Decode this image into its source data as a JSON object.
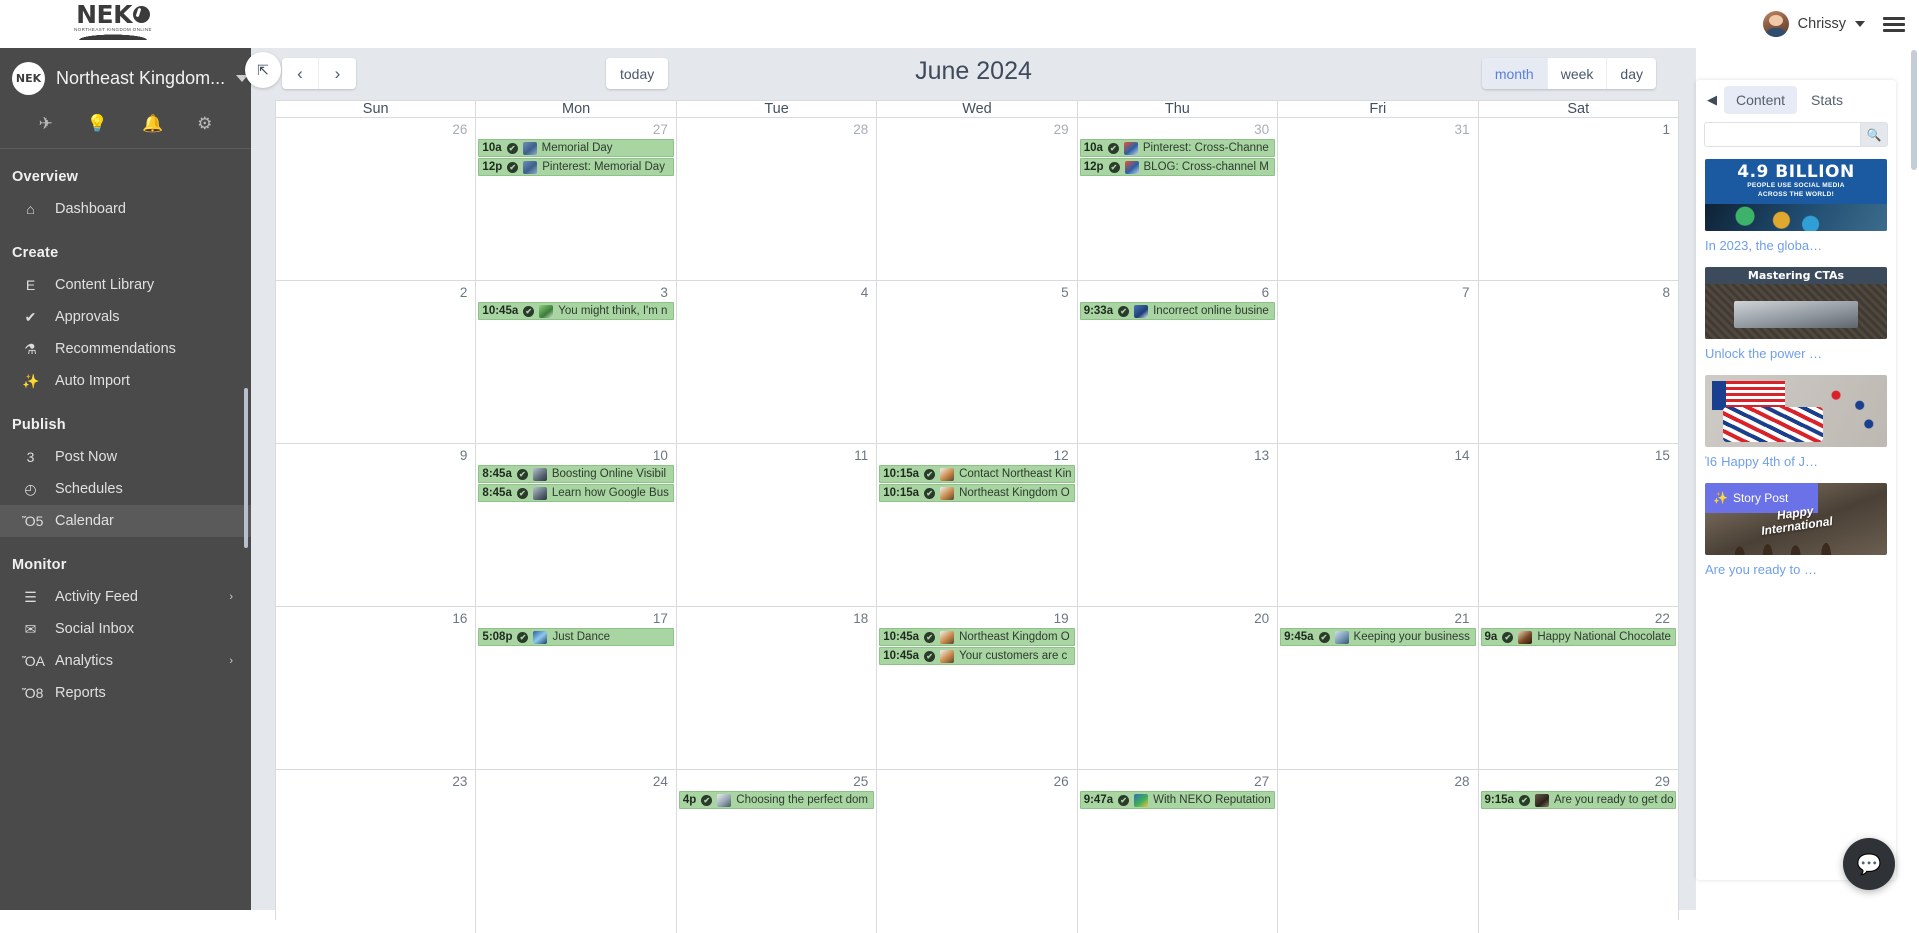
{
  "topbar": {
    "brand_word": "NEK",
    "brand_tagline": "NORTHEAST KINGDOM ONLINE",
    "user_name": "Chrissy",
    "avatar_icon": "user-avatar",
    "menu_icon": "hamburger-menu-icon"
  },
  "sidebar": {
    "account_logo_text": "NEK",
    "account_name": "Northeast Kingdom...",
    "quick_icons": [
      {
        "name": "rocket-icon",
        "glyph": "✈"
      },
      {
        "name": "lightbulb-icon",
        "glyph": "Ὂ1"
      },
      {
        "name": "bell-icon",
        "glyph": "ὑ4"
      },
      {
        "name": "gear-icon",
        "glyph": "⚙"
      }
    ],
    "sections": [
      {
        "title": "Overview",
        "items": [
          {
            "label": "Dashboard",
            "icon": "home-icon",
            "glyph": "⌂",
            "active": false,
            "chevron": false
          }
        ]
      },
      {
        "title": "Create",
        "items": [
          {
            "label": "Content Library",
            "icon": "document-image-icon",
            "glyph": "὜E",
            "active": false,
            "chevron": false
          },
          {
            "label": "Approvals",
            "icon": "check-circle-icon",
            "glyph": "✔",
            "active": false,
            "chevron": false
          },
          {
            "label": "Recommendations",
            "icon": "flask-icon",
            "glyph": "⚗",
            "active": false,
            "chevron": false
          },
          {
            "label": "Auto Import",
            "icon": "magic-wand-icon",
            "glyph": "✨",
            "active": false,
            "chevron": false
          }
        ]
      },
      {
        "title": "Publish",
        "items": [
          {
            "label": "Post Now",
            "icon": "megaphone-icon",
            "glyph": "὎3",
            "active": false,
            "chevron": false
          },
          {
            "label": "Schedules",
            "icon": "clock-icon",
            "glyph": "◴",
            "active": false,
            "chevron": false
          },
          {
            "label": "Calendar",
            "icon": "calendar-icon",
            "glyph": "Ὄ5",
            "active": true,
            "chevron": false
          }
        ]
      },
      {
        "title": "Monitor",
        "items": [
          {
            "label": "Activity Feed",
            "icon": "list-icon",
            "glyph": "☰",
            "active": false,
            "chevron": true
          },
          {
            "label": "Social Inbox",
            "icon": "envelope-icon",
            "glyph": "✉",
            "active": false,
            "chevron": false
          },
          {
            "label": "Analytics",
            "icon": "bar-chart-icon",
            "glyph": "ὌA",
            "active": false,
            "chevron": true
          },
          {
            "label": "Reports",
            "icon": "area-chart-icon",
            "glyph": "Ὄ8",
            "active": false,
            "chevron": false
          }
        ]
      }
    ]
  },
  "calendar": {
    "title": "June 2024",
    "collapse_icon": "collapse-arrows-icon",
    "prev_label": "‹",
    "next_label": "›",
    "today_label": "today",
    "views": [
      {
        "label": "month",
        "active": true
      },
      {
        "label": "week",
        "active": false
      },
      {
        "label": "day",
        "active": false
      }
    ],
    "day_headers": [
      "Sun",
      "Mon",
      "Tue",
      "Wed",
      "Thu",
      "Fri",
      "Sat"
    ],
    "weeks": [
      [
        {
          "num": "26",
          "other": true,
          "events": []
        },
        {
          "num": "27",
          "other": true,
          "events": [
            {
              "time": "10a",
              "title": "Memorial Day",
              "thumb": "t-pin"
            },
            {
              "time": "12p",
              "title": "Pinterest: Memorial Day",
              "thumb": "t-pin"
            }
          ]
        },
        {
          "num": "28",
          "other": true,
          "events": []
        },
        {
          "num": "29",
          "other": true,
          "events": []
        },
        {
          "num": "30",
          "other": true,
          "events": [
            {
              "time": "10a",
              "title": "Pinterest: Cross-Channe",
              "thumb": "t-blog"
            },
            {
              "time": "12p",
              "title": "BLOG: Cross-channel M",
              "thumb": "t-blog"
            }
          ]
        },
        {
          "num": "31",
          "other": true,
          "events": []
        },
        {
          "num": "1",
          "other": false,
          "events": []
        }
      ],
      [
        {
          "num": "2",
          "other": false,
          "events": []
        },
        {
          "num": "3",
          "other": false,
          "events": [
            {
              "time": "10:45a",
              "title": "You might think, I'm n",
              "thumb": "t-green"
            }
          ]
        },
        {
          "num": "4",
          "other": false,
          "events": []
        },
        {
          "num": "5",
          "other": false,
          "events": []
        },
        {
          "num": "6",
          "other": false,
          "events": [
            {
              "time": "9:33a",
              "title": "Incorrect online busine",
              "thumb": "t-blue"
            }
          ]
        },
        {
          "num": "7",
          "other": false,
          "events": []
        },
        {
          "num": "8",
          "other": false,
          "events": []
        }
      ],
      [
        {
          "num": "9",
          "other": false,
          "events": []
        },
        {
          "num": "10",
          "other": false,
          "events": [
            {
              "time": "8:45a",
              "title": "Boosting Online Visibil",
              "thumb": "t-lap"
            },
            {
              "time": "8:45a",
              "title": "Learn how Google Bus",
              "thumb": "t-lap"
            }
          ]
        },
        {
          "num": "11",
          "other": false,
          "events": []
        },
        {
          "num": "12",
          "other": false,
          "events": [
            {
              "time": "10:15a",
              "title": "Contact Northeast Kin",
              "thumb": "t-cat"
            },
            {
              "time": "10:15a",
              "title": "Northeast Kingdom O",
              "thumb": "t-cat"
            }
          ]
        },
        {
          "num": "13",
          "other": false,
          "events": []
        },
        {
          "num": "14",
          "other": false,
          "events": []
        },
        {
          "num": "15",
          "other": false,
          "events": []
        }
      ],
      [
        {
          "num": "16",
          "other": false,
          "events": []
        },
        {
          "num": "17",
          "other": false,
          "events": [
            {
              "time": "5:08p",
              "title": "Just Dance",
              "thumb": "t-dance"
            }
          ]
        },
        {
          "num": "18",
          "other": false,
          "events": []
        },
        {
          "num": "19",
          "other": false,
          "events": [
            {
              "time": "10:45a",
              "title": "Northeast Kingdom O",
              "thumb": "t-cat"
            },
            {
              "time": "10:45a",
              "title": "Your customers are c",
              "thumb": "t-cat"
            }
          ]
        },
        {
          "num": "20",
          "other": false,
          "events": []
        },
        {
          "num": "21",
          "other": false,
          "events": [
            {
              "time": "9:45a",
              "title": "Keeping your business",
              "thumb": "t-news"
            }
          ]
        },
        {
          "num": "22",
          "other": false,
          "events": [
            {
              "time": "9a",
              "title": "Happy National Chocolate",
              "thumb": "t-choc"
            }
          ]
        }
      ],
      [
        {
          "num": "23",
          "other": false,
          "events": []
        },
        {
          "num": "24",
          "other": false,
          "events": []
        },
        {
          "num": "25",
          "other": false,
          "events": [
            {
              "time": "4p",
              "title": "Choosing the perfect dom",
              "thumb": "t-dom"
            }
          ]
        },
        {
          "num": "26",
          "other": false,
          "events": []
        },
        {
          "num": "27",
          "other": false,
          "events": [
            {
              "time": "9:47a",
              "title": "With NEKO Reputation",
              "thumb": "t-neko"
            }
          ]
        },
        {
          "num": "28",
          "other": false,
          "events": []
        },
        {
          "num": "29",
          "other": false,
          "events": [
            {
              "time": "9:15a",
              "title": "Are you ready to get do",
              "thumb": "t-dark"
            }
          ]
        }
      ]
    ]
  },
  "right_panel": {
    "collapse_icon": "panel-collapse-left-icon",
    "tabs": [
      {
        "label": "Content",
        "active": true
      },
      {
        "label": "Stats",
        "active": false
      }
    ],
    "search_value": "",
    "search_placeholder": "",
    "search_icon": "search-icon",
    "cards": [
      {
        "thumb": "th1",
        "headline_big": "4.9 BILLION",
        "headline_sub_1": "PEOPLE USE SOCIAL MEDIA",
        "headline_sub_2": "ACROSS THE WORLD!",
        "caption": "In 2023, the globa…"
      },
      {
        "thumb": "th2",
        "headline_big": "Mastering CTAs",
        "caption": "Unlock the power …"
      },
      {
        "thumb": "th3",
        "caption": "Happy 4th of J…",
        "caption_emoji": "Ἰ6"
      },
      {
        "thumb": "th4",
        "badge_label": "Story Post",
        "badge_icon": "sparkles-icon",
        "handwriting_1": "Happy",
        "handwriting_2": "International",
        "caption": "Are you ready to …"
      }
    ]
  },
  "chat": {
    "icon": "chat-bubble-icon",
    "glyph": "ὊC"
  }
}
